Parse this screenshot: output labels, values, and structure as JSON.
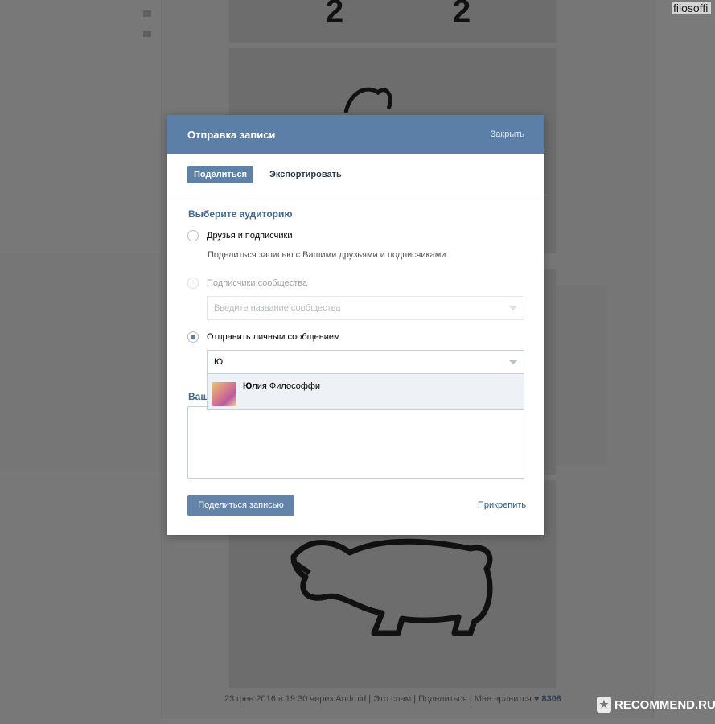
{
  "background": {
    "username": "filosoffi",
    "digits": [
      "2",
      "2"
    ],
    "footer": {
      "date": "23 фев 2016 в 19:30 через Android",
      "spam": "Это спам",
      "share": "Поделиться",
      "like": "Мне нравится",
      "likes_count": "8308"
    },
    "watermark": "RECOMMEND.RU"
  },
  "modal": {
    "title": "Отправка записи",
    "close": "Закрыть",
    "tabs": [
      {
        "label": "Поделиться",
        "active": true
      },
      {
        "label": "Экспортировать",
        "active": false
      }
    ],
    "audience_title": "Выберите аудиторию",
    "options": [
      {
        "label": "Друзья и подписчики",
        "hint": "Поделиться записью с Вашими друзьями и подписчиками",
        "checked": false
      },
      {
        "label": "Подписчики сообщества",
        "placeholder": "Введите название сообщества",
        "checked": false,
        "disabled": true
      },
      {
        "label": "Отправить личным сообщением",
        "value": "Ю",
        "checked": true
      }
    ],
    "suggestion": {
      "match": "Ю",
      "rest": "лия Философфи"
    },
    "message_label": "Ваш",
    "share_button": "Поделиться записью",
    "attach": "Прикрепить"
  },
  "colors": {
    "header": "#5b7fa6",
    "accent": "#5e81a8",
    "link": "#2b587a"
  }
}
